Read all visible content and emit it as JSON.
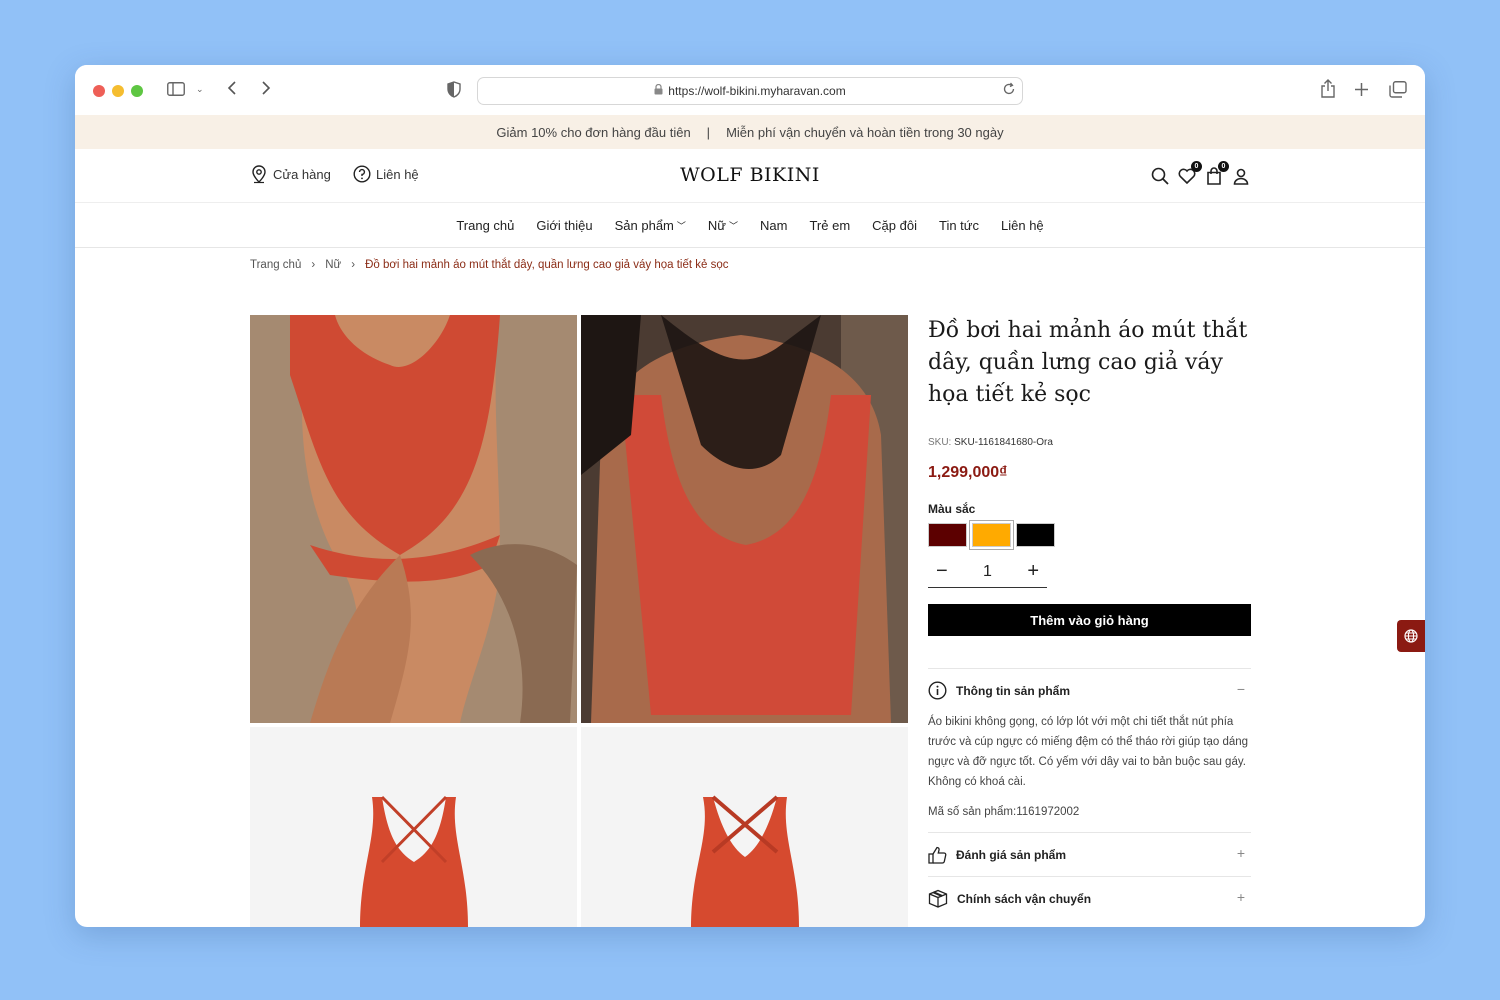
{
  "browser": {
    "url": "https://wolf-bikini.myharavan.com"
  },
  "promo": {
    "left": "Giảm 10% cho đơn hàng đầu tiên",
    "separator": "|",
    "right": "Miễn phí vận chuyển và hoàn tiền trong 30 ngày"
  },
  "header": {
    "store_label": "Cửa hàng",
    "contact_label": "Liên hệ",
    "logo": "WOLF BIKINI",
    "wishlist_count": "0",
    "cart_count": "0"
  },
  "nav": {
    "items": [
      {
        "label": "Trang chủ"
      },
      {
        "label": "Giới thiệu"
      },
      {
        "label": "Sản phẩm"
      },
      {
        "label": "Nữ"
      },
      {
        "label": "Nam"
      },
      {
        "label": "Trẻ em"
      },
      {
        "label": "Cặp đôi"
      },
      {
        "label": "Tin tức"
      },
      {
        "label": "Liên hệ"
      }
    ]
  },
  "breadcrumb": {
    "home": "Trang chủ",
    "sep": "›",
    "category": "Nữ",
    "current": "Đồ bơi hai mảnh áo mút thắt dây, quần lưng cao giả váy họa tiết kẻ sọc"
  },
  "product": {
    "title": "Đồ bơi hai mảnh áo mút thắt dây, quần lưng cao giả váy họa tiết kẻ sọc",
    "sku_label": "SKU:",
    "sku": "SKU-1161841680-Ora",
    "price": "1,299,000₫",
    "color_label": "Màu sắc",
    "colors": [
      "#5c0000",
      "#ffaa00",
      "#000000"
    ],
    "quantity": "1",
    "qty_minus": "−",
    "qty_plus": "+",
    "add_to_cart": "Thêm vào giỏ hàng"
  },
  "accordion": {
    "info_title": "Thông tin sản phẩm",
    "info_toggle": "−",
    "info_text": "Áo bikini không gọng, có lớp lót với một chi tiết thắt nút phía trước và cúp ngực có miếng đệm có thể tháo rời giúp tạo dáng ngực và đỡ ngực tốt. Có yếm với dây vai to bản buộc sau gáy. Không có khoá cài.",
    "info_code": "Mã số sản phẩm:1161972002",
    "review_title": "Đánh giá sản phẩm",
    "review_toggle": "+",
    "shipping_title": "Chính sách vận chuyển",
    "shipping_toggle": "+"
  }
}
